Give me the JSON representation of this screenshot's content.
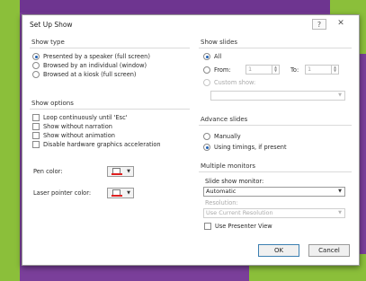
{
  "dialog": {
    "title": "Set Up Show",
    "help_glyph": "?",
    "close_glyph": "✕"
  },
  "show_type": {
    "title": "Show type",
    "options": [
      {
        "label": "Presented by a speaker (full screen)",
        "checked": true
      },
      {
        "label": "Browsed by an individual (window)",
        "checked": false
      },
      {
        "label": "Browsed at a kiosk (full screen)",
        "checked": false
      }
    ]
  },
  "show_options": {
    "title": "Show options",
    "checkboxes": [
      {
        "label": "Loop continuously until 'Esc'",
        "checked": false
      },
      {
        "label": "Show without narration",
        "checked": false
      },
      {
        "label": "Show without animation",
        "checked": false
      },
      {
        "label": "Disable hardware graphics acceleration",
        "checked": false
      }
    ],
    "pen_color_label": "Pen color:",
    "laser_color_label": "Laser pointer color:",
    "pen_color": "#e02020",
    "laser_color": "#e02020"
  },
  "show_slides": {
    "title": "Show slides",
    "all_label": "All",
    "from_label": "From:",
    "from_value": "1",
    "to_label": "To:",
    "to_value": "1",
    "custom_label": "Custom show:"
  },
  "advance_slides": {
    "title": "Advance slides",
    "manually_label": "Manually",
    "timings_label": "Using timings, if present"
  },
  "monitors": {
    "title": "Multiple monitors",
    "slide_monitor_label": "Slide show monitor:",
    "slide_monitor_value": "Automatic",
    "resolution_label": "Resolution:",
    "resolution_value": "Use Current Resolution",
    "presenter_view_label": "Use Presenter View"
  },
  "buttons": {
    "ok": "OK",
    "cancel": "Cancel"
  }
}
